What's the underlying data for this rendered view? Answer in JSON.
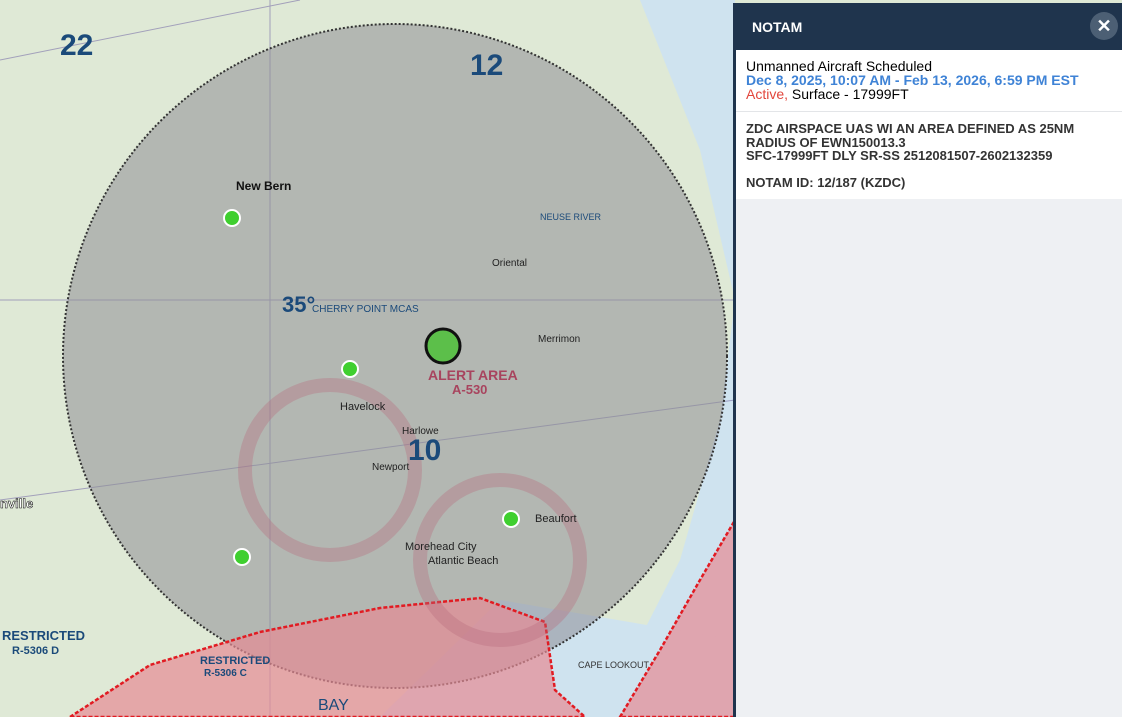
{
  "map": {
    "labels": {
      "new_bern": "New Bern",
      "havelock": "Havelock",
      "morehead_city": "Morehead City",
      "beaufort": "Beaufort",
      "atlantic_beach": "Atlantic Beach",
      "alert_area": "ALERT AREA",
      "alert_area_id": "A-530",
      "restricted_left": "RESTRICTED",
      "restricted_left_id": "R-5306 D",
      "restricted_c": "RESTRICTED",
      "restricted_c_id": "R-5306 C",
      "cape_lookout": "CAPE LOOKOUT",
      "cherry_point": "CHERRY POINT MCAS",
      "onslow_bay": "BAY",
      "jacksonville": "nville",
      "num_12": "12",
      "num_10": "10",
      "num_22": "22",
      "lat_35": "35°",
      "merrimon": "Merrimon",
      "harlowe": "Harlowe",
      "newport": "Newport",
      "oriental": "Oriental",
      "neuse_river": "NEUSE RIVER"
    },
    "colors": {
      "land": "#dfe9d6",
      "water": "#cfe3ef",
      "overlay": "#8e8e96",
      "restricted": "#e58a94",
      "restricted_border": "#e11b22"
    }
  },
  "panel": {
    "title": "NOTAM",
    "close_icon": "close-icon",
    "type": "Unmanned Aircraft Scheduled",
    "dates": "Dec 8, 2025, 10:07 AM - Feb 13, 2026, 6:59 PM EST",
    "status": "Active,",
    "altitude": "Surface - 17999FT",
    "text_line1": "ZDC AIRSPACE UAS WI AN AREA DEFINED AS 25NM",
    "text_line2": "RADIUS OF EWN150013.3",
    "text_line3": "SFC-17999FT DLY SR-SS 2512081507-2602132359",
    "notam_id": "NOTAM ID: 12/187 (KZDC)"
  }
}
